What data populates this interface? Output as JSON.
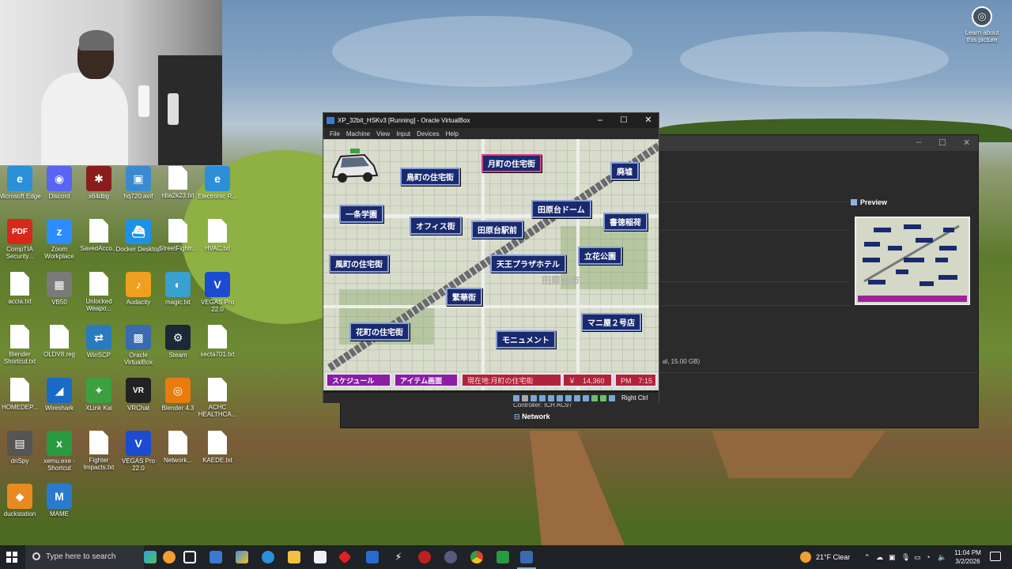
{
  "learn_about": {
    "label": "Learn about this picture"
  },
  "desktop_icons": [
    {
      "label": "Microsoft Edge",
      "color": "#2a8fd8",
      "kind": "app",
      "glyph": "e"
    },
    {
      "label": "Discord",
      "color": "#5865f2",
      "kind": "app",
      "glyph": "◉"
    },
    {
      "label": "x64dbg",
      "color": "#8a1c1c",
      "kind": "app",
      "glyph": "✱"
    },
    {
      "label": "hq720.avif",
      "color": "#3a8ad0",
      "kind": "app",
      "glyph": "▣"
    },
    {
      "label": "nba2k23.txt",
      "kind": "doc"
    },
    {
      "label": "Electronic R...",
      "color": "#2a8fd8",
      "kind": "app",
      "glyph": "e"
    },
    {
      "label": "CompTIA Security...",
      "color": "#d8281c",
      "kind": "app",
      "glyph": "PDF"
    },
    {
      "label": "Zoom Workplace",
      "color": "#2d8cff",
      "kind": "app",
      "glyph": "z"
    },
    {
      "label": "SavedAcco...",
      "kind": "doc"
    },
    {
      "label": "Docker Desktop",
      "color": "#1d91e6",
      "kind": "app",
      "glyph": "⛴"
    },
    {
      "label": "StreetFightr...",
      "kind": "doc"
    },
    {
      "label": "HVAC.txt",
      "kind": "doc"
    },
    {
      "label": "accia.txt",
      "kind": "doc"
    },
    {
      "label": "VB50",
      "color": "#7a7a7a",
      "kind": "app",
      "glyph": "▦"
    },
    {
      "label": "Unlocked Weapo...",
      "kind": "doc"
    },
    {
      "label": "Audacity",
      "color": "#f0a020",
      "kind": "app",
      "glyph": "♪"
    },
    {
      "label": "magic.txt",
      "color": "#3aa0d0",
      "kind": "app",
      "glyph": "◐"
    },
    {
      "label": "VEGAS Pro 22.0",
      "color": "#1a4bd0",
      "kind": "app",
      "glyph": "V"
    },
    {
      "label": "Blender Shortcut.txt",
      "kind": "doc"
    },
    {
      "label": "OLDV8.reg",
      "kind": "doc"
    },
    {
      "label": "WinSCP",
      "color": "#2a7ac0",
      "kind": "app",
      "glyph": "⇄"
    },
    {
      "label": "Oracle VirtualBox",
      "color": "#3a6ab0",
      "kind": "app",
      "glyph": "▩"
    },
    {
      "label": "Steam",
      "color": "#1b2838",
      "kind": "app",
      "glyph": "⚙"
    },
    {
      "label": "secta701.txt",
      "kind": "doc"
    },
    {
      "label": "HOMEDEP...",
      "kind": "doc"
    },
    {
      "label": "Wireshark",
      "color": "#1a6ac8",
      "kind": "app",
      "glyph": "◢"
    },
    {
      "label": "XLink Kai",
      "color": "#3aa040",
      "kind": "app",
      "glyph": "✦"
    },
    {
      "label": "VRChat",
      "color": "#222222",
      "kind": "app",
      "glyph": "VR"
    },
    {
      "label": "Blender 4.3",
      "color": "#e87d0d",
      "kind": "app",
      "glyph": "◎"
    },
    {
      "label": "ACHC HEALTHCA...",
      "kind": "doc"
    },
    {
      "label": "dnSpy",
      "color": "#555555",
      "kind": "app",
      "glyph": "▤"
    },
    {
      "label": "xemu.exe - Shortcut",
      "color": "#2a9a40",
      "kind": "app",
      "glyph": "x"
    },
    {
      "label": "Fighter Impacts.txt",
      "kind": "doc"
    },
    {
      "label": "VEGAS Pro 22.0",
      "color": "#1a4bd0",
      "kind": "app",
      "glyph": "V"
    },
    {
      "label": "Network...",
      "kind": "doc"
    },
    {
      "label": "KAEDE.txt",
      "kind": "doc"
    },
    {
      "label": "duckstation",
      "color": "#e88a20",
      "kind": "app",
      "glyph": "◆"
    },
    {
      "label": "MAME",
      "color": "#2a7ad0",
      "kind": "app",
      "glyph": "M"
    }
  ],
  "manager": {
    "preview_label": "Preview",
    "storage_text": "al, 15.00 GB)",
    "controller_text": "Controller:   ICH AC97",
    "network_label": "Network"
  },
  "vm": {
    "title": "XP_32bit_HSKv3 [Running] - Oracle VirtualBox",
    "menu": [
      "File",
      "Machine",
      "View",
      "Input",
      "Devices",
      "Help"
    ],
    "host_key": "Right Ctrl",
    "controls": {
      "minimize": "–",
      "maximize": "☐",
      "close": "✕"
    }
  },
  "game": {
    "city_label": "田原台市",
    "locations": [
      {
        "label": "月町の住宅街",
        "selected": true
      },
      {
        "label": "鳥町の住宅街",
        "selected": false
      },
      {
        "label": "廃墟",
        "selected": false
      },
      {
        "label": "一条学園",
        "selected": false
      },
      {
        "label": "田原台ドーム",
        "selected": false
      },
      {
        "label": "オフィス街",
        "selected": false
      },
      {
        "label": "田原台駅前",
        "selected": false
      },
      {
        "label": "書徳稲荷",
        "selected": false
      },
      {
        "label": "風町の住宅街",
        "selected": false
      },
      {
        "label": "天王プラザホテル",
        "selected": false
      },
      {
        "label": "立花公園",
        "selected": false
      },
      {
        "label": "繁華街",
        "selected": false
      },
      {
        "label": "花町の住宅街",
        "selected": false
      },
      {
        "label": "マニ屋２号店",
        "selected": false
      },
      {
        "label": "モニュメント",
        "selected": false
      }
    ],
    "hud": {
      "schedule": "スケジュール",
      "items": "アイテム画面",
      "location": "現在地:月町の住宅街",
      "money": "￥　14,360",
      "time": "PM　7:15"
    }
  },
  "taskbar": {
    "search_placeholder": "Type here to search",
    "weather": "21°F  Clear",
    "time": "11:04 PM",
    "date": "3/2/2026"
  }
}
